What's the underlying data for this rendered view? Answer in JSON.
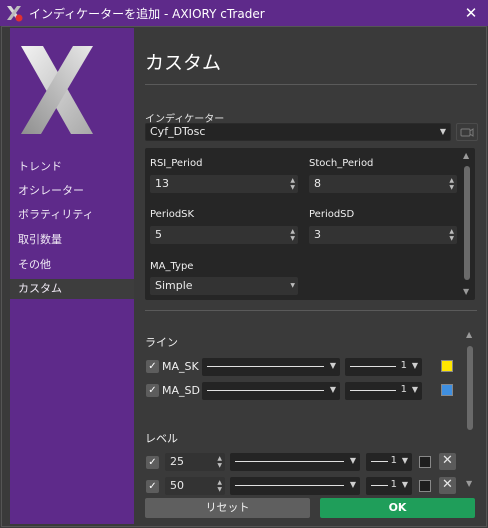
{
  "window": {
    "title": "インディケーターを追加 - AXIORY cTrader",
    "close_glyph": "✕"
  },
  "sidebar": {
    "items": [
      {
        "label": "トレンド"
      },
      {
        "label": "オシレーター"
      },
      {
        "label": "ボラティリティ"
      },
      {
        "label": "取引数量"
      },
      {
        "label": "その他"
      },
      {
        "label": "カスタム"
      }
    ],
    "active_index": 5
  },
  "main": {
    "heading": "カスタム",
    "indicator_label": "インディケーター",
    "indicator_value": "Cyf_DTosc",
    "params": {
      "rsi_period_label": "RSI_Period",
      "rsi_period_value": "13",
      "stoch_period_label": "Stoch_Period",
      "stoch_period_value": "8",
      "periodsk_label": "PeriodSK",
      "periodsk_value": "5",
      "periodsd_label": "PeriodSD",
      "periodsd_value": "3",
      "matype_label": "MA_Type",
      "matype_value": "Simple"
    },
    "lines_section": {
      "title": "ライン",
      "rows": [
        {
          "label": "MA_SK",
          "thickness": "1",
          "color": "#ffe600"
        },
        {
          "label": "MA_SD",
          "thickness": "1",
          "color": "#3f8fe0"
        }
      ]
    },
    "levels_section": {
      "title": "レベル",
      "rows": [
        {
          "value": "25",
          "thickness": "1"
        },
        {
          "value": "50",
          "thickness": "1"
        }
      ],
      "remove_glyph": "✕"
    },
    "reset_label": "リセット",
    "ok_label": "OK"
  },
  "colors": {
    "accent_purple": "#5e2a8a",
    "ok_green": "#1f9e5a"
  }
}
